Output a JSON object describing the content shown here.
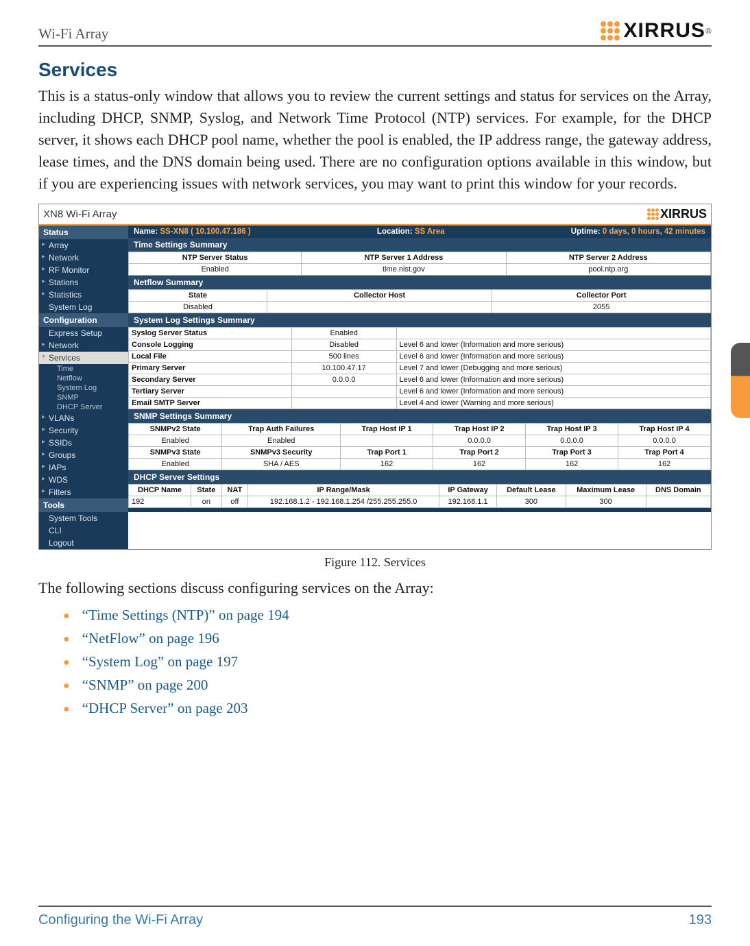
{
  "header": {
    "wifi": "Wi-Fi Array",
    "brand": "XIRRUS"
  },
  "title": "Services",
  "paragraph": "This is a status-only window that allows you to review the current settings and status for services on the Array, including DHCP, SNMP, Syslog, and Network Time Protocol (NTP) services. For example, for the DHCP server, it shows each DHCP pool name, whether the pool is enabled, the IP address range, the gateway address, lease times, and the DNS domain being used. There are no configuration options available in this window, but if you are experiencing issues with network services, you may want to print this window for your records.",
  "screenshot": {
    "window_title": "XN8 Wi-Fi Array",
    "brand": "XIRRUS",
    "info": {
      "name_label": "Name:",
      "name_value": "SS-XN8   ( 10.100.47.186 )",
      "location_label": "Location:",
      "location_value": "SS Area",
      "uptime_label": "Uptime:",
      "uptime_value": "0 days, 0 hours, 42 minutes"
    },
    "sidebar": {
      "s1": "Status",
      "i1": "Array",
      "i2": "Network",
      "i3": "RF Monitor",
      "i4": "Stations",
      "i5": "Statistics",
      "i6": "System Log",
      "s2": "Configuration",
      "i7": "Express Setup",
      "i8": "Network",
      "i9": "Services",
      "sub1": "Time",
      "sub2": "Netflow",
      "sub3": "System Log",
      "sub4": "SNMP",
      "sub5": "DHCP Server",
      "i10": "VLANs",
      "i11": "Security",
      "i12": "SSIDs",
      "i13": "Groups",
      "i14": "IAPs",
      "i15": "WDS",
      "i16": "Filters",
      "s3": "Tools",
      "i17": "System Tools",
      "i18": "CLI",
      "i19": "Logout"
    },
    "sections": {
      "time": {
        "title": "Time Settings Summary",
        "h1": "NTP Server Status",
        "h2": "NTP Server 1 Address",
        "h3": "NTP Server 2 Address",
        "v1": "Enabled",
        "v2": "time.nist.gov",
        "v3": "pool.ntp.org"
      },
      "netflow": {
        "title": "Netflow Summary",
        "h1": "State",
        "h2": "Collector Host",
        "h3": "Collector Port",
        "v1": "Disabled",
        "v2": "",
        "v3": "2055"
      },
      "syslog": {
        "title": "System Log Settings Summary",
        "rows": [
          {
            "label": "Syslog Server Status",
            "val": "Enabled",
            "level": ""
          },
          {
            "label": "Console Logging",
            "val": "Disabled",
            "level": "Level 6 and lower (Information and more serious)"
          },
          {
            "label": "Local File",
            "val": "500 lines",
            "level": "Level 6 and lower (Information and more serious)"
          },
          {
            "label": "Primary Server",
            "val": "10.100.47.17",
            "level": "Level 7 and lower (Debugging and more serious)"
          },
          {
            "label": "Secondary Server",
            "val": "0.0.0.0",
            "level": "Level 6 and lower (Information and more serious)"
          },
          {
            "label": "Tertiary Server",
            "val": "",
            "level": "Level 6 and lower (Information and more serious)"
          },
          {
            "label": "Email SMTP Server",
            "val": "",
            "level": "Level 4 and lower (Warning and more serious)"
          }
        ]
      },
      "snmp": {
        "title": "SNMP Settings Summary",
        "r1": {
          "c1": "SNMPv2 State",
          "c2": "Trap Auth Failures",
          "c3": "Trap Host IP 1",
          "c4": "Trap Host IP 2",
          "c5": "Trap Host IP 3",
          "c6": "Trap Host IP 4"
        },
        "r2": {
          "c1": "Enabled",
          "c2": "Enabled",
          "c3": "",
          "c4": "0.0.0.0",
          "c5": "0.0.0.0",
          "c6": "0.0.0.0"
        },
        "r3": {
          "c1": "SNMPv3 State",
          "c2": "SNMPv3 Security",
          "c3": "Trap Port 1",
          "c4": "Trap Port 2",
          "c5": "Trap Port 3",
          "c6": "Trap Port 4"
        },
        "r4": {
          "c1": "Enabled",
          "c2": "SHA / AES",
          "c3": "162",
          "c4": "162",
          "c5": "162",
          "c6": "162"
        }
      },
      "dhcp": {
        "title": "DHCP Server Settings",
        "h1": "DHCP Name",
        "h2": "State",
        "h3": "NAT",
        "h4": "IP Range/Mask",
        "h5": "IP Gateway",
        "h6": "Default Lease",
        "h7": "Maximum Lease",
        "h8": "DNS Domain",
        "v1": "192",
        "v2": "on",
        "v3": "off",
        "v4": "192.168.1.2 - 192.168.1.254 /255.255.255.0",
        "v5": "192.168.1.1",
        "v6": "300",
        "v7": "300",
        "v8": ""
      }
    }
  },
  "caption": "Figure 112. Services",
  "lead": "The following sections discuss configuring services on the Array:",
  "links": {
    "l1": "“Time Settings (NTP)” on page 194",
    "l2": "“NetFlow” on page 196",
    "l3": "“System Log” on page 197",
    "l4": "“SNMP” on page 200",
    "l5": "“DHCP Server” on page 203"
  },
  "footer": {
    "left": "Configuring the Wi-Fi Array",
    "right": "193"
  }
}
